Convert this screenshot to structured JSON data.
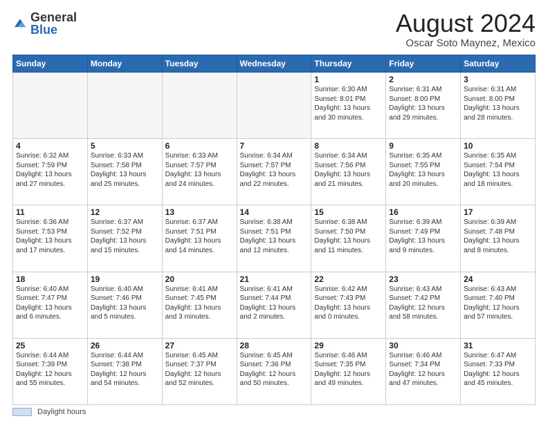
{
  "header": {
    "logo_general": "General",
    "logo_blue": "Blue",
    "title": "August 2024",
    "subtitle": "Oscar Soto Maynez, Mexico"
  },
  "days_of_week": [
    "Sunday",
    "Monday",
    "Tuesday",
    "Wednesday",
    "Thursday",
    "Friday",
    "Saturday"
  ],
  "weeks": [
    [
      {
        "day": "",
        "info": ""
      },
      {
        "day": "",
        "info": ""
      },
      {
        "day": "",
        "info": ""
      },
      {
        "day": "",
        "info": ""
      },
      {
        "day": "1",
        "info": "Sunrise: 6:30 AM\nSunset: 8:01 PM\nDaylight: 13 hours\nand 30 minutes."
      },
      {
        "day": "2",
        "info": "Sunrise: 6:31 AM\nSunset: 8:00 PM\nDaylight: 13 hours\nand 29 minutes."
      },
      {
        "day": "3",
        "info": "Sunrise: 6:31 AM\nSunset: 8:00 PM\nDaylight: 13 hours\nand 28 minutes."
      }
    ],
    [
      {
        "day": "4",
        "info": "Sunrise: 6:32 AM\nSunset: 7:59 PM\nDaylight: 13 hours\nand 27 minutes."
      },
      {
        "day": "5",
        "info": "Sunrise: 6:33 AM\nSunset: 7:58 PM\nDaylight: 13 hours\nand 25 minutes."
      },
      {
        "day": "6",
        "info": "Sunrise: 6:33 AM\nSunset: 7:57 PM\nDaylight: 13 hours\nand 24 minutes."
      },
      {
        "day": "7",
        "info": "Sunrise: 6:34 AM\nSunset: 7:57 PM\nDaylight: 13 hours\nand 22 minutes."
      },
      {
        "day": "8",
        "info": "Sunrise: 6:34 AM\nSunset: 7:56 PM\nDaylight: 13 hours\nand 21 minutes."
      },
      {
        "day": "9",
        "info": "Sunrise: 6:35 AM\nSunset: 7:55 PM\nDaylight: 13 hours\nand 20 minutes."
      },
      {
        "day": "10",
        "info": "Sunrise: 6:35 AM\nSunset: 7:54 PM\nDaylight: 13 hours\nand 18 minutes."
      }
    ],
    [
      {
        "day": "11",
        "info": "Sunrise: 6:36 AM\nSunset: 7:53 PM\nDaylight: 13 hours\nand 17 minutes."
      },
      {
        "day": "12",
        "info": "Sunrise: 6:37 AM\nSunset: 7:52 PM\nDaylight: 13 hours\nand 15 minutes."
      },
      {
        "day": "13",
        "info": "Sunrise: 6:37 AM\nSunset: 7:51 PM\nDaylight: 13 hours\nand 14 minutes."
      },
      {
        "day": "14",
        "info": "Sunrise: 6:38 AM\nSunset: 7:51 PM\nDaylight: 13 hours\nand 12 minutes."
      },
      {
        "day": "15",
        "info": "Sunrise: 6:38 AM\nSunset: 7:50 PM\nDaylight: 13 hours\nand 11 minutes."
      },
      {
        "day": "16",
        "info": "Sunrise: 6:39 AM\nSunset: 7:49 PM\nDaylight: 13 hours\nand 9 minutes."
      },
      {
        "day": "17",
        "info": "Sunrise: 6:39 AM\nSunset: 7:48 PM\nDaylight: 13 hours\nand 8 minutes."
      }
    ],
    [
      {
        "day": "18",
        "info": "Sunrise: 6:40 AM\nSunset: 7:47 PM\nDaylight: 13 hours\nand 6 minutes."
      },
      {
        "day": "19",
        "info": "Sunrise: 6:40 AM\nSunset: 7:46 PM\nDaylight: 13 hours\nand 5 minutes."
      },
      {
        "day": "20",
        "info": "Sunrise: 6:41 AM\nSunset: 7:45 PM\nDaylight: 13 hours\nand 3 minutes."
      },
      {
        "day": "21",
        "info": "Sunrise: 6:41 AM\nSunset: 7:44 PM\nDaylight: 13 hours\nand 2 minutes."
      },
      {
        "day": "22",
        "info": "Sunrise: 6:42 AM\nSunset: 7:43 PM\nDaylight: 13 hours\nand 0 minutes."
      },
      {
        "day": "23",
        "info": "Sunrise: 6:43 AM\nSunset: 7:42 PM\nDaylight: 12 hours\nand 58 minutes."
      },
      {
        "day": "24",
        "info": "Sunrise: 6:43 AM\nSunset: 7:40 PM\nDaylight: 12 hours\nand 57 minutes."
      }
    ],
    [
      {
        "day": "25",
        "info": "Sunrise: 6:44 AM\nSunset: 7:39 PM\nDaylight: 12 hours\nand 55 minutes."
      },
      {
        "day": "26",
        "info": "Sunrise: 6:44 AM\nSunset: 7:38 PM\nDaylight: 12 hours\nand 54 minutes."
      },
      {
        "day": "27",
        "info": "Sunrise: 6:45 AM\nSunset: 7:37 PM\nDaylight: 12 hours\nand 52 minutes."
      },
      {
        "day": "28",
        "info": "Sunrise: 6:45 AM\nSunset: 7:36 PM\nDaylight: 12 hours\nand 50 minutes."
      },
      {
        "day": "29",
        "info": "Sunrise: 6:46 AM\nSunset: 7:35 PM\nDaylight: 12 hours\nand 49 minutes."
      },
      {
        "day": "30",
        "info": "Sunrise: 6:46 AM\nSunset: 7:34 PM\nDaylight: 12 hours\nand 47 minutes."
      },
      {
        "day": "31",
        "info": "Sunrise: 6:47 AM\nSunset: 7:33 PM\nDaylight: 12 hours\nand 45 minutes."
      }
    ]
  ],
  "footer": {
    "swatch_label": "Daylight hours"
  }
}
